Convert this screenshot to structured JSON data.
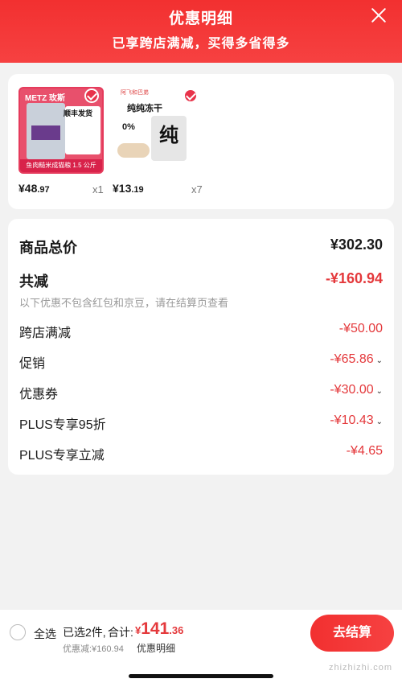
{
  "header": {
    "title": "优惠明细",
    "subtitle": "已享跨店满减，买得多省得多"
  },
  "products": [
    {
      "image_brand": "METZ 玫斯",
      "image_badge": "顺丰发货",
      "image_caption": "鱼肉糙米成猫粮 1.5 公斤",
      "price_int": "¥48",
      "price_dec": ".97",
      "qty": "x1"
    },
    {
      "image_brand": "阿飞和巴弟",
      "image_name": "纯纯冻干",
      "image_pct": "0%",
      "image_char": "纯",
      "price_int": "¥13",
      "price_dec": ".19",
      "qty": "x7"
    }
  ],
  "summary": {
    "total_label": "商品总价",
    "total_value": "¥302.30",
    "reduce_label": "共减",
    "reduce_value": "-¥160.94",
    "note": "以下优惠不包含红包和京豆，请在结算页查看",
    "items": [
      {
        "label": "跨店满减",
        "value": "-¥50.00",
        "arrow": ""
      },
      {
        "label": "促销",
        "value": "-¥65.86",
        "arrow": "⌄"
      },
      {
        "label": "优惠券",
        "value": "-¥30.00",
        "arrow": "⌄"
      },
      {
        "label": "PLUS专享95折",
        "value": "-¥10.43",
        "arrow": "⌄"
      },
      {
        "label": "PLUS专享立减",
        "value": "-¥4.65",
        "arrow": ""
      }
    ]
  },
  "bottom": {
    "select_all": "全选",
    "selected_count": "已选2件,",
    "total_label": "合计:",
    "total_yen": "¥",
    "total_int": "141",
    "total_dec": ".36",
    "discount_line": "优惠减:¥160.94",
    "detail_link": "优惠明细",
    "checkout_label": "去结算",
    "watermark": "zhizhizhi.com"
  },
  "colors": {
    "accent": "#f23030",
    "price_red": "#e4393c"
  }
}
